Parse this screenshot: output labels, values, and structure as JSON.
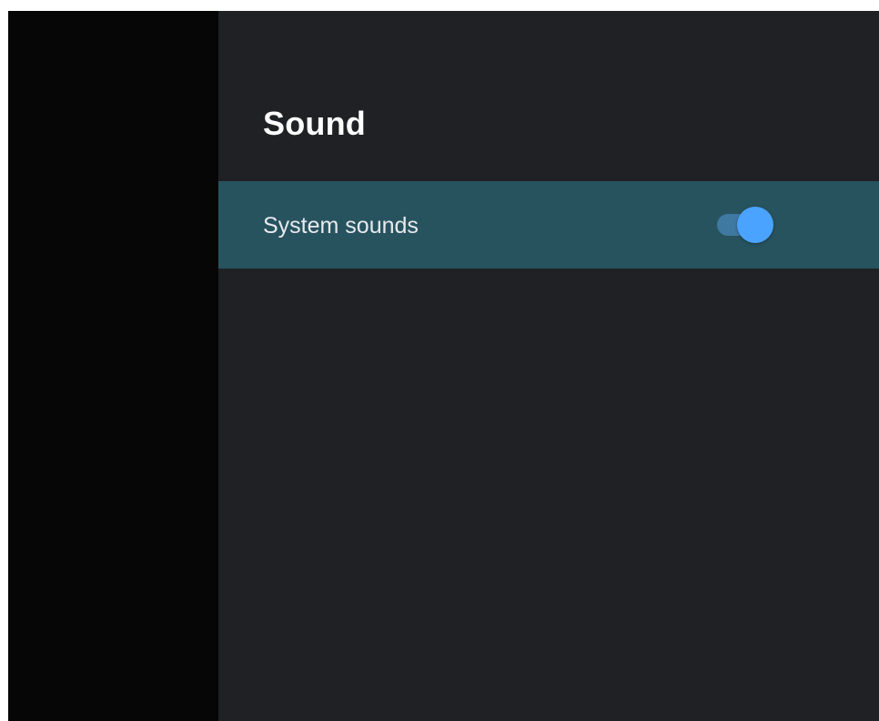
{
  "settings": {
    "title": "Sound",
    "items": [
      {
        "label": "System sounds",
        "toggle_state": "on"
      }
    ]
  },
  "colors": {
    "left_pane": "#060606",
    "panel_background": "#202124",
    "selected_row": "#27535f",
    "toggle_track": "#3f79a2",
    "toggle_thumb": "#4aa3ff",
    "title_text": "#ffffff",
    "label_text": "#e8eaed"
  }
}
